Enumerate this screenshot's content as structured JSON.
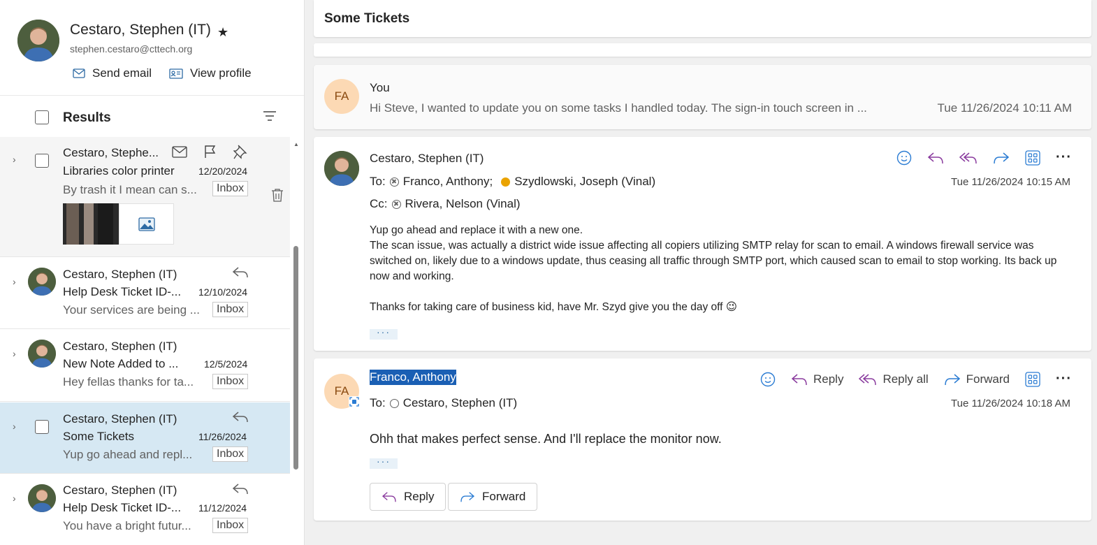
{
  "contact_card": {
    "name": "Cestaro, Stephen (IT)",
    "email": "stephen.cestaro@cttech.org",
    "send_email_label": "Send email",
    "view_profile_label": "View profile"
  },
  "results": {
    "label": "Results"
  },
  "message_list": [
    {
      "sender": "Cestaro, Stephe...",
      "subject": "Libraries color printer",
      "date": "12/20/2024",
      "preview": "By trash it I mean can s...",
      "folder": "Inbox"
    },
    {
      "sender": "Cestaro, Stephen (IT)",
      "subject": "Help Desk Ticket ID-...",
      "date": "12/10/2024",
      "preview": "Your services are being ...",
      "folder": "Inbox"
    },
    {
      "sender": "Cestaro, Stephen (IT)",
      "subject": "New Note Added to ...",
      "date": "12/5/2024",
      "preview": "Hey fellas thanks for ta...",
      "folder": "Inbox"
    },
    {
      "sender": "Cestaro, Stephen (IT)",
      "subject": "Some Tickets",
      "date": "11/26/2024",
      "preview": "Yup go ahead and repl...",
      "folder": "Inbox",
      "selected": true
    },
    {
      "sender": "Cestaro, Stephen (IT)",
      "subject": "Help Desk Ticket ID-...",
      "date": "11/12/2024",
      "preview": "You have a bright futur...",
      "folder": "Inbox"
    }
  ],
  "conversation": {
    "subject": "Some Tickets",
    "collapsed": {
      "initials": "FA",
      "from": "You",
      "preview": "Hi Steve, I wanted to update you on some tasks I handled today. The sign-in touch screen in ...",
      "date": "Tue 11/26/2024 10:11 AM"
    },
    "expanded": {
      "from": "Cestaro, Stephen (IT)",
      "to_label": "To:",
      "to": [
        "Franco, Anthony;",
        "Szydlowski, Joseph (Vinal)"
      ],
      "cc_label": "Cc:",
      "cc": [
        "Rivera, Nelson (Vinal)"
      ],
      "date": "Tue 11/26/2024 10:15 AM",
      "body": "Yup go ahead and replace it with a new one.\nThe scan issue, was actually a district wide issue affecting all copiers utilizing SMTP relay for scan to email. A windows firewall service was switched on, likely due to a windows update, thus ceasing all traffic through SMTP port, which caused scan to email to stop working. Its back up now and working.\n\nThanks for taking care of business kid, have Mr. Szyd give you the day off 😉",
      "more": "···"
    },
    "latest": {
      "initials": "FA",
      "from": "Franco, Anthony",
      "to_label": "To:",
      "to": [
        "Cestaro, Stephen (IT)"
      ],
      "date": "Tue 11/26/2024 10:18 AM",
      "body": "Ohh that makes perfect sense. And I'll replace the monitor now.",
      "more": "···",
      "reply_label": "Reply",
      "reply_all_label": "Reply all",
      "forward_label": "Forward",
      "reply_button_label": "Reply",
      "forward_button_label": "Forward"
    }
  },
  "colors": {
    "selected_row": "#d6e8f3",
    "initials_bg": "#fcd9b4",
    "highlight": "#1a5fb4",
    "reply_purple": "#8a3b9e",
    "forward_blue": "#2b7cd3"
  }
}
